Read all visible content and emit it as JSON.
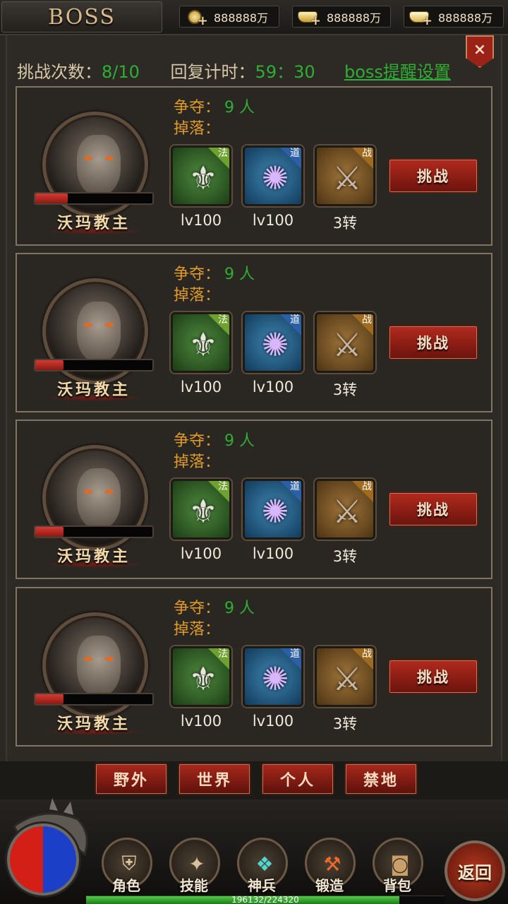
{
  "header": {
    "title": "BOSS",
    "currencies": [
      {
        "icon": "gold-coin-icon",
        "value": "888888万"
      },
      {
        "icon": "gold-ingot-icon",
        "value": "888888万"
      },
      {
        "icon": "silver-ingot-icon",
        "value": "888888万"
      }
    ]
  },
  "close_icon": "×",
  "info": {
    "challenge_label": "挑战次数：",
    "challenge_value": "8/10",
    "recover_label": "回复计时：",
    "recover_value": "59：30",
    "reminder_link": "boss提醒设置"
  },
  "bosses": [
    {
      "name": "沃玛教主",
      "hp": 0.28,
      "contest_label": "争夺：",
      "contest_value": "9 人",
      "drop_label": "掉落：",
      "drops": [
        {
          "tag": "法",
          "label": "lv100",
          "class": "fa"
        },
        {
          "tag": "道",
          "label": "lv100",
          "class": "dao"
        },
        {
          "tag": "战",
          "label": "3转",
          "class": "zhan"
        }
      ],
      "button": "挑战"
    },
    {
      "name": "沃玛教主",
      "hp": 0.24,
      "contest_label": "争夺：",
      "contest_value": "9 人",
      "drop_label": "掉落：",
      "drops": [
        {
          "tag": "法",
          "label": "lv100",
          "class": "fa"
        },
        {
          "tag": "道",
          "label": "lv100",
          "class": "dao"
        },
        {
          "tag": "战",
          "label": "3转",
          "class": "zhan"
        }
      ],
      "button": "挑战"
    },
    {
      "name": "沃玛教主",
      "hp": 0.24,
      "contest_label": "争夺：",
      "contest_value": "9 人",
      "drop_label": "掉落：",
      "drops": [
        {
          "tag": "法",
          "label": "lv100",
          "class": "fa"
        },
        {
          "tag": "道",
          "label": "lv100",
          "class": "dao"
        },
        {
          "tag": "战",
          "label": "3转",
          "class": "zhan"
        }
      ],
      "button": "挑战"
    },
    {
      "name": "沃玛教主",
      "hp": 0.24,
      "contest_label": "争夺：",
      "contest_value": "9 人",
      "drop_label": "掉落：",
      "drops": [
        {
          "tag": "法",
          "label": "lv100",
          "class": "fa"
        },
        {
          "tag": "道",
          "label": "lv100",
          "class": "dao"
        },
        {
          "tag": "战",
          "label": "3转",
          "class": "zhan"
        }
      ],
      "button": "挑战"
    }
  ],
  "tabs": [
    "野外",
    "世界",
    "个人",
    "禁地"
  ],
  "nav": [
    {
      "label": "角色",
      "icon": "armor-icon"
    },
    {
      "label": "技能",
      "icon": "skill-book-icon"
    },
    {
      "label": "神兵",
      "icon": "divine-weapon-icon"
    },
    {
      "label": "锻造",
      "icon": "anvil-icon"
    },
    {
      "label": "背包",
      "icon": "bag-icon"
    }
  ],
  "back_button": "返回",
  "exp": {
    "text": "196132/224320",
    "fraction": 0.874
  }
}
